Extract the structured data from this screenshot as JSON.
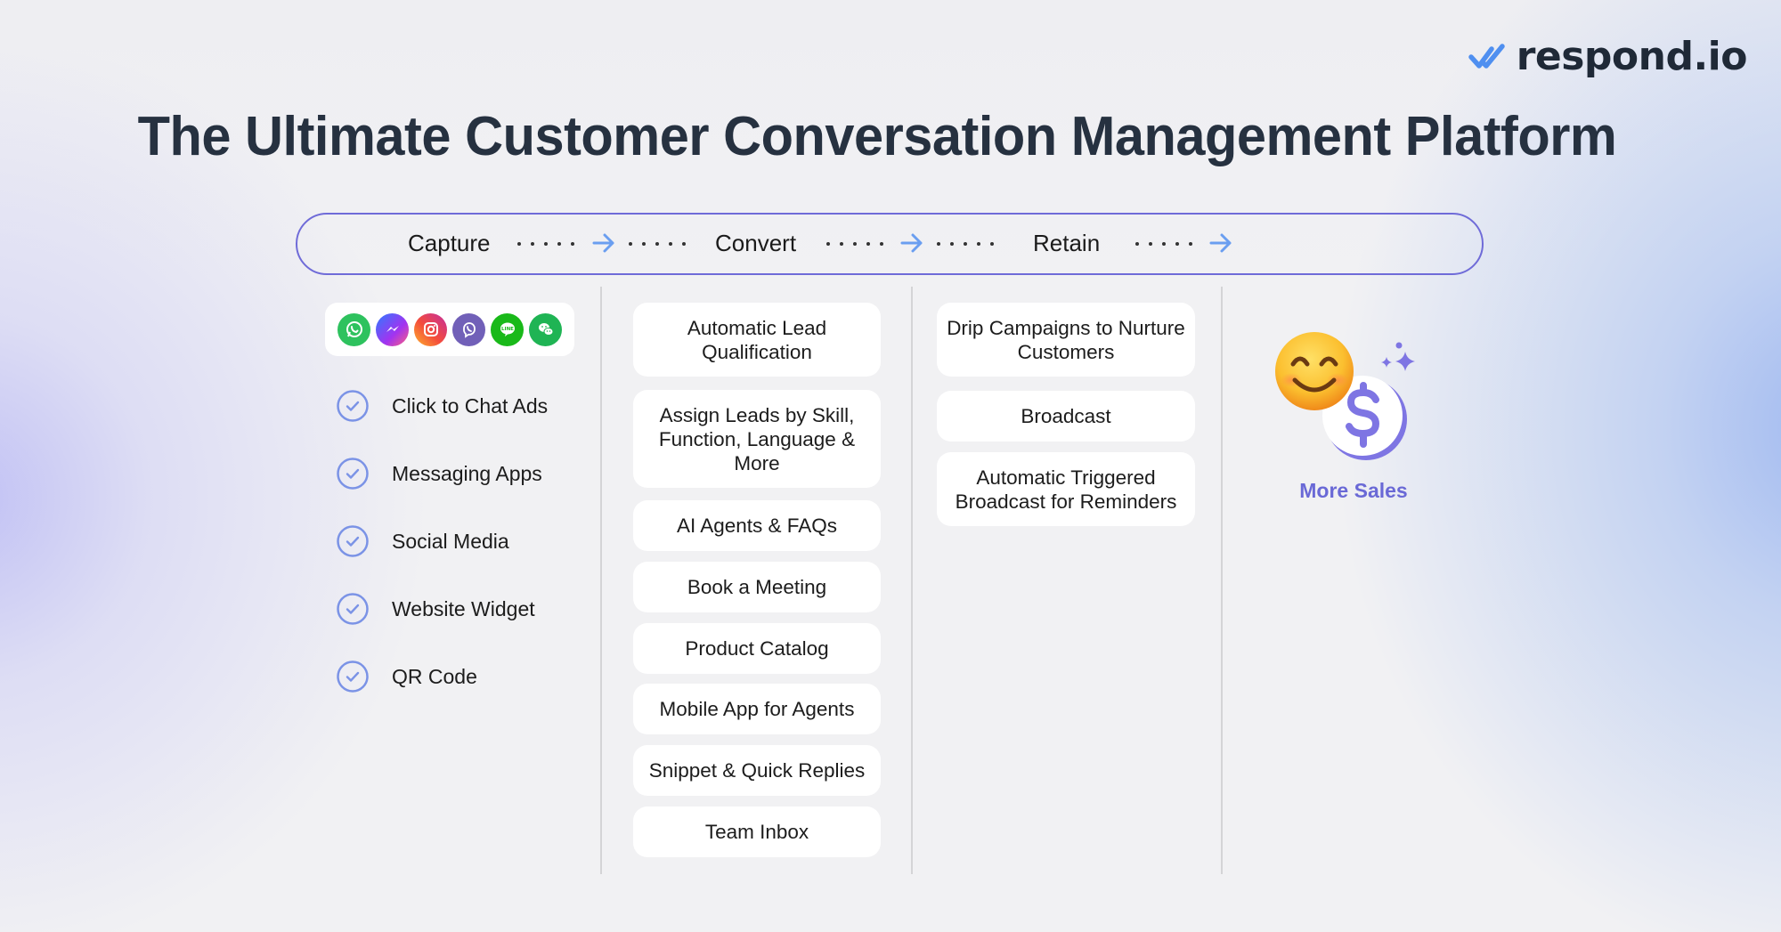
{
  "brand": {
    "logo_text": "respond.io",
    "logo_icon": "double-check-logo-icon",
    "accent_color": "#4f8ff0"
  },
  "title": "The Ultimate Customer Conversation Management Platform",
  "pipeline": {
    "border_color": "#6f6bd8",
    "arrow_color": "#6a9ef0",
    "stages": [
      {
        "label": "Capture"
      },
      {
        "label": "Convert"
      },
      {
        "label": "Retain"
      }
    ]
  },
  "capture": {
    "channels": [
      {
        "name": "WhatsApp",
        "icon": "whatsapp-icon",
        "color": "#2ec25e"
      },
      {
        "name": "Messenger",
        "icon": "messenger-icon",
        "color": "#8a3cf0"
      },
      {
        "name": "Instagram",
        "icon": "instagram-icon",
        "color": "#e8316b"
      },
      {
        "name": "Viber",
        "icon": "viber-icon",
        "color": "#7160b8"
      },
      {
        "name": "LINE",
        "icon": "line-icon",
        "color": "#19b919",
        "glyph": "LINE"
      },
      {
        "name": "WeChat",
        "icon": "wechat-icon",
        "color": "#1fb454"
      }
    ],
    "items": [
      {
        "label": "Click to Chat Ads"
      },
      {
        "label": "Messaging Apps"
      },
      {
        "label": "Social Media"
      },
      {
        "label": "Website Widget"
      },
      {
        "label": "QR Code"
      }
    ],
    "check_color": "#7b93e6"
  },
  "convert": {
    "items": [
      {
        "label": "Automatic Lead Qualification"
      },
      {
        "label": "Assign Leads by Skill, Function, Language & More"
      },
      {
        "label": "AI Agents & FAQs"
      },
      {
        "label": "Book a Meeting"
      },
      {
        "label": "Product Catalog"
      },
      {
        "label": "Mobile App for Agents"
      },
      {
        "label": "Snippet & Quick Replies"
      },
      {
        "label": "Team Inbox"
      }
    ]
  },
  "retain": {
    "items": [
      {
        "label": "Drip Campaigns to Nurture Customers"
      },
      {
        "label": "Broadcast"
      },
      {
        "label": "Automatic Triggered Broadcast for Reminders"
      }
    ]
  },
  "outcome": {
    "label": "More Sales",
    "emoji": "😊",
    "color": "#6a69d6"
  }
}
